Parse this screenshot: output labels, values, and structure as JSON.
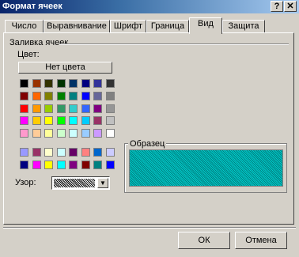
{
  "titlebar": {
    "title": "Формат ячеек",
    "help_label": "?",
    "close_label": "✕"
  },
  "tabs": [
    {
      "label": "Число"
    },
    {
      "label": "Выравнивание"
    },
    {
      "label": "Шрифт"
    },
    {
      "label": "Граница"
    },
    {
      "label": "Вид",
      "active": true
    },
    {
      "label": "Защита"
    }
  ],
  "shading": {
    "group_label": "Заливка ячеек",
    "color_label": "Цвет:",
    "no_color_button": "Нет цвета",
    "pattern_label": "Узор:"
  },
  "palette": {
    "rows": [
      [
        "#000000",
        "#993300",
        "#333300",
        "#003300",
        "#003366",
        "#000080",
        "#333399",
        "#333333"
      ],
      [
        "#800000",
        "#FF6600",
        "#808000",
        "#008000",
        "#008080",
        "#0000FF",
        "#666699",
        "#808080"
      ],
      [
        "#FF0000",
        "#FF9900",
        "#99CC00",
        "#339966",
        "#33CCCC",
        "#3366FF",
        "#800080",
        "#969696"
      ],
      [
        "#FF00FF",
        "#FFCC00",
        "#FFFF00",
        "#00FF00",
        "#00FFFF",
        "#00CCFF",
        "#993366",
        "#C0C0C0"
      ],
      [
        "#FF99CC",
        "#FFCC99",
        "#FFFF99",
        "#CCFFCC",
        "#CCFFFF",
        "#99CCFF",
        "#CC99FF",
        "#FFFFFF"
      ]
    ],
    "extra_rows": [
      [
        "#9999FF",
        "#993366",
        "#FFFFCC",
        "#CCFFFF",
        "#660066",
        "#FF8080",
        "#0066CC",
        "#CCCCFF"
      ],
      [
        "#000080",
        "#FF00FF",
        "#FFFF00",
        "#00FFFF",
        "#800080",
        "#800000",
        "#008080",
        "#0000FF"
      ]
    ]
  },
  "sample": {
    "label": "Образец",
    "color": "#00CCCC"
  },
  "buttons": {
    "ok": "ОК",
    "cancel": "Отмена"
  }
}
